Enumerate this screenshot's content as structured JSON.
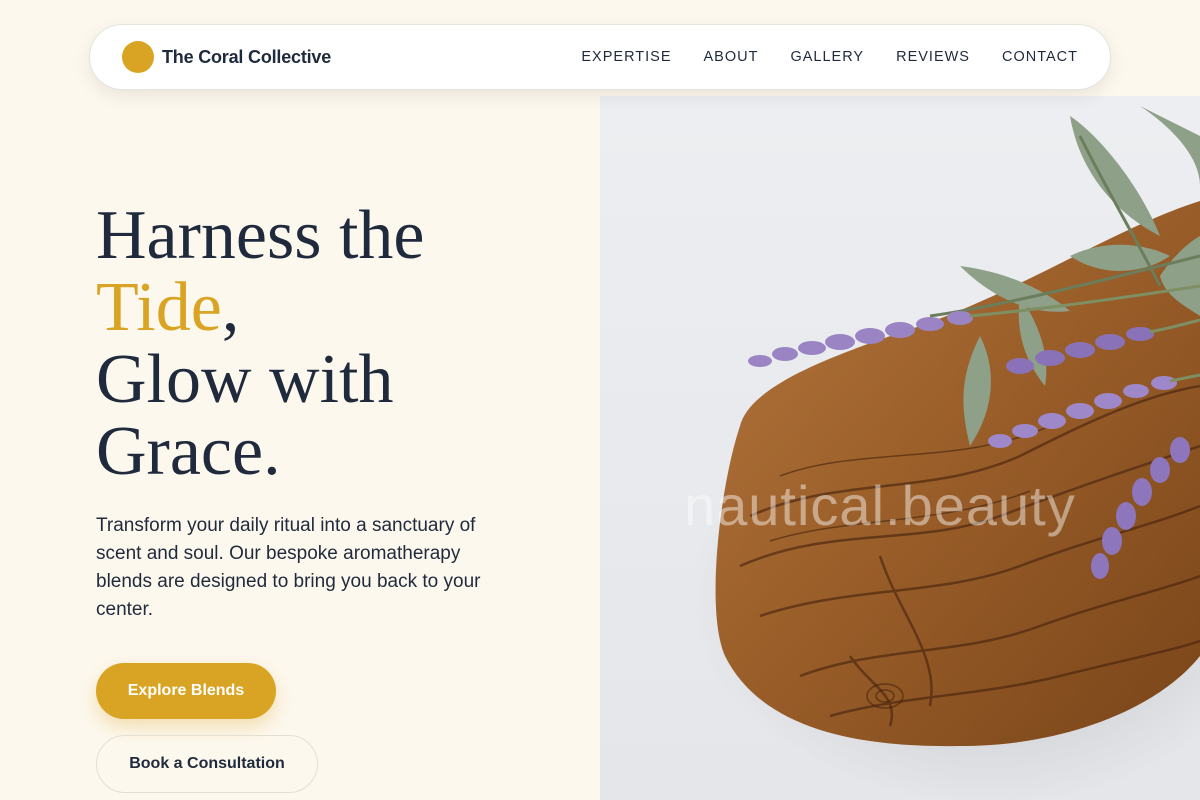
{
  "nav": {
    "brand_name": "The Coral Collective",
    "links": [
      "EXPERTISE",
      "ABOUT",
      "GALLERY",
      "REVIEWS",
      "CONTACT"
    ]
  },
  "hero": {
    "title_line1": "Harness the",
    "title_accent": "Tide",
    "title_comma": ",",
    "title_line3": "Glow with",
    "title_line4": "Grace.",
    "body": "Transform your daily ritual into a sanctuary of scent and soul. Our bespoke aromatherapy blends are designed to bring you back to your center.",
    "primary_button": "Explore Blends",
    "secondary_button": "Book a Consultation"
  },
  "image": {
    "subject": "lavender sprigs on an olive wood cutting board",
    "watermark": "nautical.beauty"
  },
  "colors": {
    "background": "#fdf8ee",
    "accent": "#d9a423",
    "text": "#1f2a3c",
    "white": "#ffffff"
  }
}
